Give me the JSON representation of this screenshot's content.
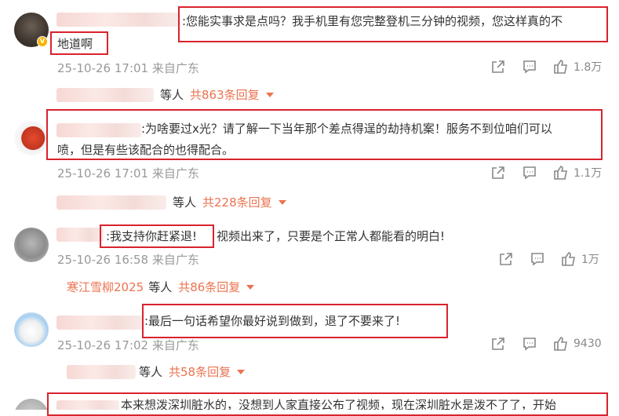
{
  "comments": [
    {
      "text_line1": ":您能实事求是点吗？我手机里有您完整登机三分钟的视频，您这样真的不",
      "text_line2": "地道啊",
      "time": "25-10-26 17:01",
      "source": "来自广东",
      "likes": "1.8万",
      "reply_prefix": "",
      "reply_suffix": "等人",
      "reply_count": "共863条回复",
      "verified_badge": "V"
    },
    {
      "text_line1": ":为啥要过x光？请了解一下当年那个差点得逞的劫持机案！服务不到位咱们可以",
      "text_line2": "喷，但是有些该配合的也得配合。",
      "time": "25-10-26 17:01",
      "source": "来自广东",
      "likes": "1.1万",
      "reply_prefix": "",
      "reply_suffix": "等人",
      "reply_count": "共228条回复"
    },
    {
      "text_highlight": ":我支持你赶紧退!",
      "text_rest": "视频出来了，只要是个正常人都能看的明白!",
      "time": "25-10-26 16:58",
      "source": "来自广东",
      "likes": "1万",
      "reply_prefix": "寒江雪柳2025",
      "reply_suffix": "等人",
      "reply_count": "共86条回复"
    },
    {
      "text_line1": ":最后一句话希望你最好说到做到，退了不要来了!",
      "time": "25-10-26 17:02",
      "source": "来自广东",
      "likes": "9430",
      "reply_prefix": "",
      "reply_suffix": "等人",
      "reply_count": "共58条回复"
    },
    {
      "text_line1": "本来想泼深圳脏水的，没想到人家直接公布了视频，现在深圳脏水是泼不了了，开始"
    }
  ],
  "icons": {
    "share": "share-icon",
    "comment": "comment-icon",
    "like": "thumbs-up-icon"
  },
  "colors": {
    "highlight_box": "#d9232d",
    "link_orange": "#eb7350",
    "meta_gray": "#999999"
  }
}
